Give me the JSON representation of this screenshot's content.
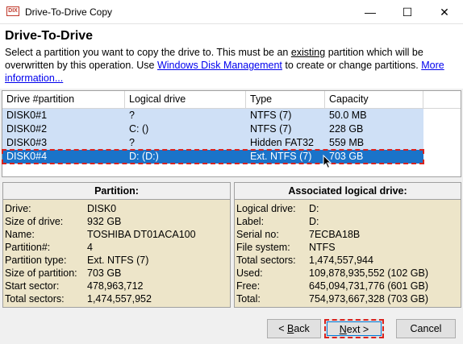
{
  "window": {
    "icon_text": "DIX",
    "title": "Drive-To-Drive Copy",
    "minimize": "—",
    "maximize": "☐",
    "close": "✕"
  },
  "header": {
    "title": "Drive-To-Drive",
    "desc_1": "Select a partition you want to copy the drive to. This must be an ",
    "desc_existing": "existing",
    "desc_2": " partition which will be overwritten by this operation. Use ",
    "desc_link_disk": "Windows Disk Management",
    "desc_3": " to create or change partitions. ",
    "desc_link_more": "More information..."
  },
  "table": {
    "columns": [
      "Drive #partition",
      "Logical drive",
      "Type",
      "Capacity"
    ],
    "rows": [
      [
        "DISK0#1",
        "?",
        "NTFS (7)",
        "50.0 MB"
      ],
      [
        "DISK0#2",
        "C: ()",
        "NTFS (7)",
        "228 GB"
      ],
      [
        "DISK0#3",
        "?",
        "Hidden FAT32",
        "559 MB"
      ],
      [
        "DISK0#4",
        "D: (D:)",
        "Ext. NTFS (7)",
        "703 GB"
      ]
    ],
    "selected_index": 3
  },
  "partition": {
    "title": "Partition:",
    "rows": [
      [
        "Drive:",
        "DISK0"
      ],
      [
        "Size of drive:",
        "932 GB"
      ],
      [
        "Name:",
        "TOSHIBA DT01ACA100"
      ],
      [
        "Partition#:",
        "4"
      ],
      [
        "Partition type:",
        "Ext. NTFS (7)"
      ],
      [
        "Size of partition:",
        "703 GB"
      ],
      [
        "Start sector:",
        "478,963,712"
      ],
      [
        "Total sectors:",
        "1,474,557,952"
      ]
    ]
  },
  "logical": {
    "title": "Associated logical drive:",
    "rows": [
      [
        "Logical drive:",
        "D:"
      ],
      [
        "Label:",
        "D:"
      ],
      [
        "Serial no:",
        "7ECBA18B"
      ],
      [
        "File system:",
        "NTFS"
      ],
      [
        "Total sectors:",
        "1,474,557,944"
      ],
      [
        "Used:",
        "109,878,935,552 (102 GB)"
      ],
      [
        "Free:",
        "645,094,731,776 (601 GB)"
      ],
      [
        "Total:",
        "754,973,667,328 (703 GB)"
      ]
    ]
  },
  "buttons": {
    "back_prefix": "< ",
    "back_accel": "B",
    "back_rest": "ack",
    "next_accel": "N",
    "next_rest": "ext >",
    "cancel": "Cancel"
  },
  "colors": {
    "row_bg": "#cfe0f6",
    "selected_bg": "#1a73c9",
    "highlight_dash": "#d8231f",
    "panel_bg": "#ede5c9"
  }
}
